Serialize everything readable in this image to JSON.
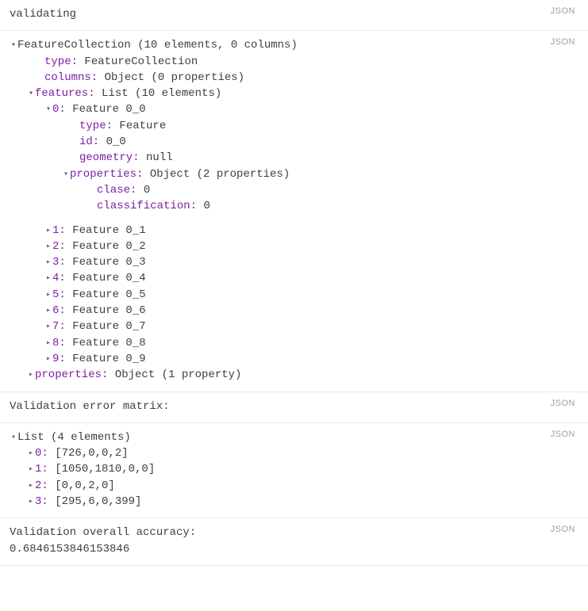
{
  "badge": "JSON",
  "section1": {
    "title": "validating"
  },
  "section2": {
    "header": "FeatureCollection (10 elements, 0 columns)",
    "type": {
      "k": "type:",
      "v": "FeatureCollection"
    },
    "columns": {
      "k": "columns:",
      "v": "Object (0 properties)"
    },
    "features": {
      "k": "features:",
      "v": "List (10 elements)"
    },
    "item0": {
      "header": {
        "k": "0:",
        "v": "Feature 0_0"
      },
      "type": {
        "k": "type:",
        "v": "Feature"
      },
      "id": {
        "k": "id:",
        "v": "0_0"
      },
      "geometry": {
        "k": "geometry:",
        "v": "null"
      },
      "properties": {
        "k": "properties:",
        "v": "Object (2 properties)"
      },
      "clase": {
        "k": "clase:",
        "v": "0"
      },
      "classification": {
        "k": "classification:",
        "v": "0"
      }
    },
    "items": [
      {
        "k": "1:",
        "v": "Feature 0_1"
      },
      {
        "k": "2:",
        "v": "Feature 0_2"
      },
      {
        "k": "3:",
        "v": "Feature 0_3"
      },
      {
        "k": "4:",
        "v": "Feature 0_4"
      },
      {
        "k": "5:",
        "v": "Feature 0_5"
      },
      {
        "k": "6:",
        "v": "Feature 0_6"
      },
      {
        "k": "7:",
        "v": "Feature 0_7"
      },
      {
        "k": "8:",
        "v": "Feature 0_8"
      },
      {
        "k": "9:",
        "v": "Feature 0_9"
      }
    ],
    "props": {
      "k": "properties:",
      "v": "Object (1 property)"
    }
  },
  "section3": {
    "title": "Validation error matrix:"
  },
  "section4": {
    "header": "List (4 elements)",
    "rows": [
      {
        "k": "0:",
        "v": "[726,0,0,2]"
      },
      {
        "k": "1:",
        "v": "[1050,1810,0,0]"
      },
      {
        "k": "2:",
        "v": "[0,0,2,0]"
      },
      {
        "k": "3:",
        "v": "[295,6,0,399]"
      }
    ]
  },
  "section5": {
    "title": "Validation overall accuracy:",
    "value": "0.6846153846153846"
  }
}
